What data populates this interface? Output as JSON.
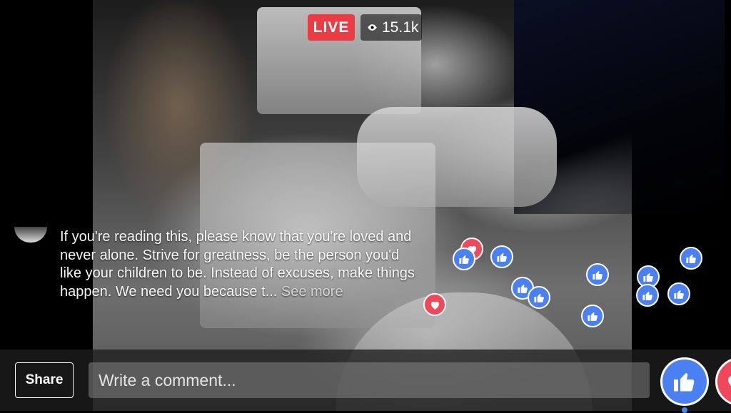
{
  "stream": {
    "live_label": "LIVE",
    "viewer_count": "15.1k",
    "viewer_icon": "eye-icon"
  },
  "comment": {
    "text": "If you're reading this, please know that you're loved and never alone. Strive for greatness, be the person you'd like your children to be. Instead of excuses, make things happen. We need you because t...",
    "see_more_label": "See more"
  },
  "reactions": [
    {
      "type": "love"
    },
    {
      "type": "like"
    },
    {
      "type": "like"
    },
    {
      "type": "like"
    },
    {
      "type": "like"
    },
    {
      "type": "like"
    },
    {
      "type": "love"
    },
    {
      "type": "like"
    },
    {
      "type": "like"
    },
    {
      "type": "like"
    },
    {
      "type": "like"
    },
    {
      "type": "like"
    }
  ],
  "bottom_bar": {
    "share_label": "Share",
    "comment_placeholder": "Write a comment...",
    "like_icon": "thumbs-up-icon",
    "love_icon": "heart-icon"
  },
  "colors": {
    "live_red": "#ed3b44",
    "like_blue": "#4a80f2",
    "love_red": "#f0485a"
  }
}
